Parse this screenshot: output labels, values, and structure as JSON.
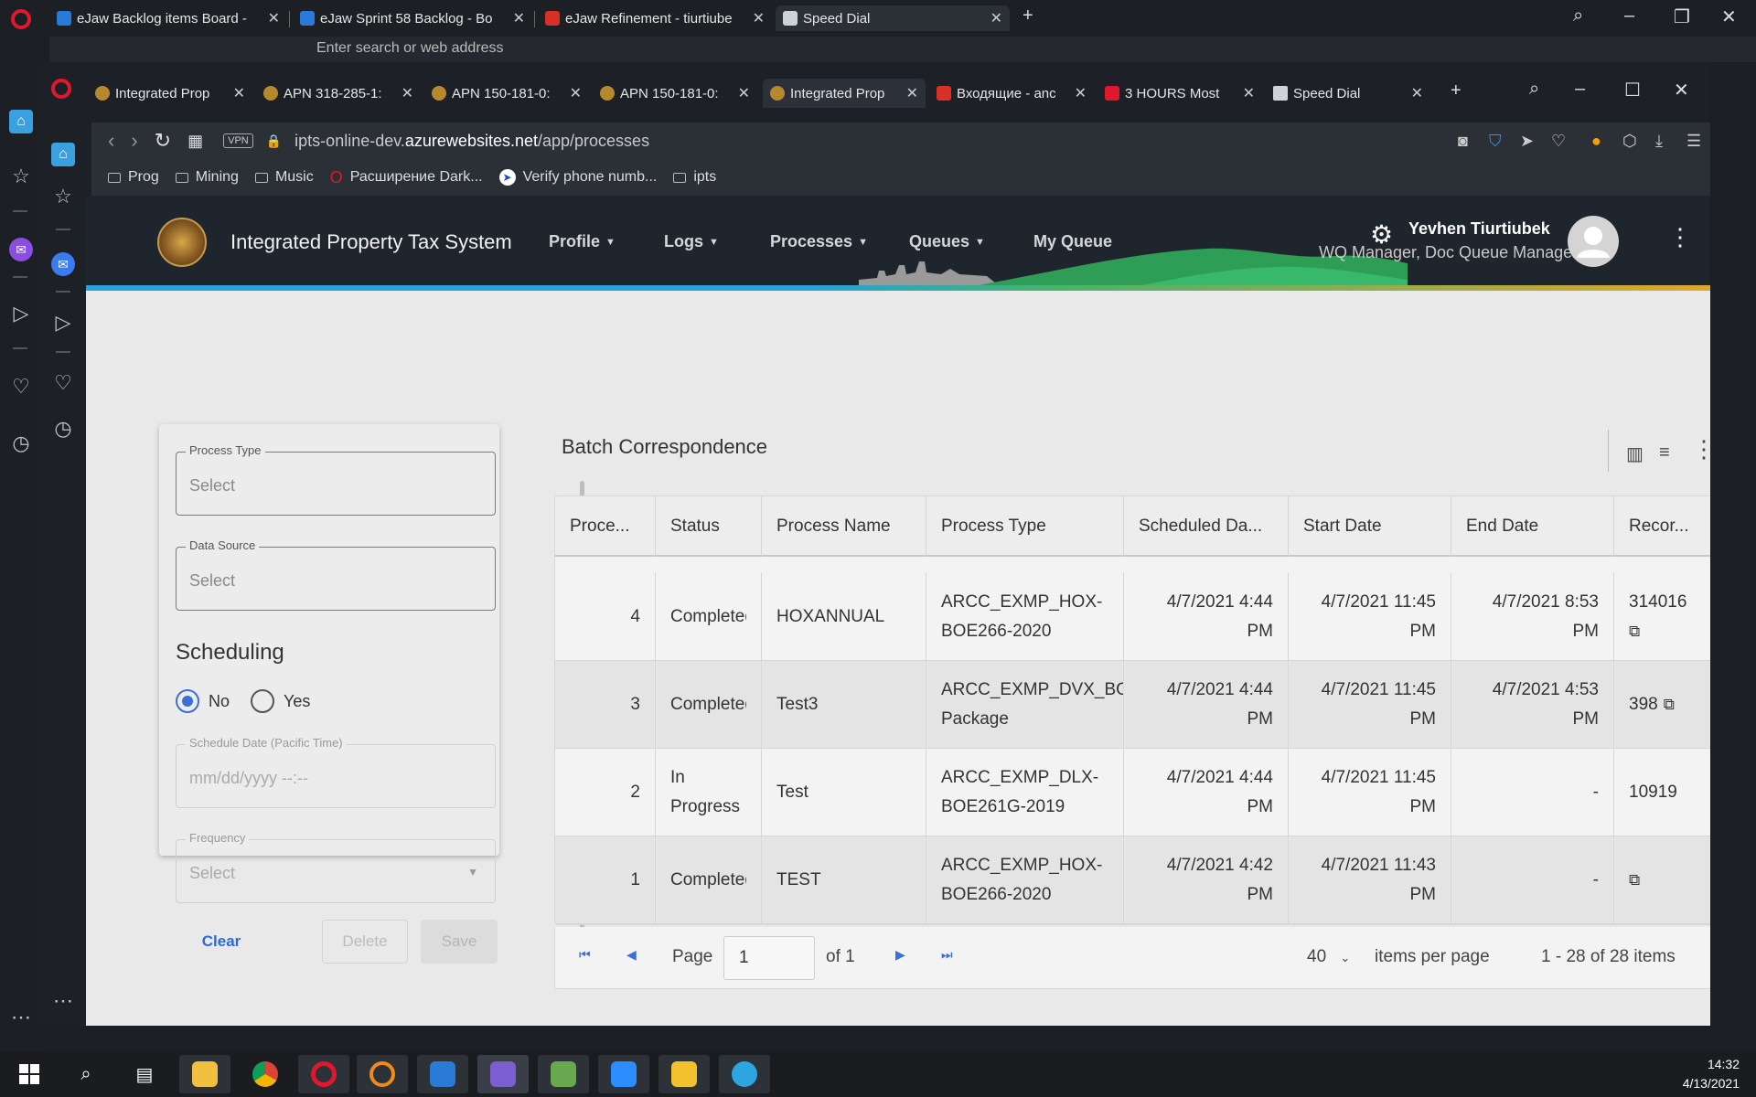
{
  "outer_tabs": [
    {
      "title": "eJaw Backlog items Board - ",
      "color": "#2a7bd8"
    },
    {
      "title": "eJaw Sprint 58 Backlog - Bo",
      "color": "#2a7bd8"
    },
    {
      "title": "eJaw Refinement - tiurtiube",
      "color": "#d93025"
    },
    {
      "title": "Speed Dial",
      "color": "#cfd3d8"
    }
  ],
  "outer_address_placeholder": "Enter search or web address",
  "inner_tabs": [
    {
      "title": "Integrated Prop"
    },
    {
      "title": "APN 318-285-1:"
    },
    {
      "title": "APN 150-181-0:"
    },
    {
      "title": "APN 150-181-0:"
    },
    {
      "title": "Integrated Prop"
    },
    {
      "title": "Входящие - anc"
    },
    {
      "title": "3 HOURS Most"
    },
    {
      "title": "Speed Dial"
    }
  ],
  "address": {
    "vpn": "VPN",
    "url_prefix": "ipts-online-dev.",
    "url_domain": "azurewebsites.net",
    "url_path": "/app/processes"
  },
  "bookmarks": [
    {
      "label": "Prog"
    },
    {
      "label": "Mining"
    },
    {
      "label": "Music"
    },
    {
      "label": "Расширение Dark..."
    },
    {
      "label": "Verify phone numb..."
    },
    {
      "label": "ipts"
    }
  ],
  "header": {
    "app_title": "Integrated Property Tax System",
    "menus": [
      "Profile",
      "Logs",
      "Processes",
      "Queues"
    ],
    "my_queue": "My Queue",
    "user_name": "Yevhen Tiurtiubek",
    "user_role": "WQ Manager, Doc Queue Manager"
  },
  "filters": {
    "process_type": {
      "label": "Process Type",
      "value": "Select"
    },
    "data_source": {
      "label": "Data Source",
      "value": "Select"
    },
    "scheduling_heading": "Scheduling",
    "radio_no": "No",
    "radio_yes": "Yes",
    "schedule_date": {
      "label": "Schedule Date (Pacific Time)",
      "value": "mm/dd/yyyy --:--"
    },
    "frequency": {
      "label": "Frequency",
      "value": "Select"
    },
    "clear": "Clear",
    "delete": "Delete",
    "save": "Save"
  },
  "table": {
    "title": "Batch Correspondence",
    "columns": [
      "Proce...",
      "Status",
      "Process Name",
      "Process Type",
      "Scheduled Da...",
      "Start Date",
      "End Date",
      "Recor..."
    ],
    "rows": [
      {
        "id": "4",
        "status": "Completed",
        "name": "HOXANNUAL",
        "type1": "ARCC_EXMP_HOX-",
        "type2": "BOE266-2020",
        "sched1": "4/7/2021 4:44",
        "sched2": "PM",
        "start1": "4/7/2021 11:45",
        "start2": "PM",
        "end1": "4/7/2021 8:53",
        "end2": "PM",
        "records": "314016"
      },
      {
        "id": "3",
        "status": "Completed",
        "name": "Test3",
        "type1": "ARCC_EXMP_DVX_BOE",
        "type2": "Package",
        "sched1": "4/7/2021 4:44",
        "sched2": "PM",
        "start1": "4/7/2021 11:45",
        "start2": "PM",
        "end1": "4/7/2021 4:53",
        "end2": "PM",
        "records": "398"
      },
      {
        "id": "2",
        "status1": "In",
        "status2": "Progress",
        "name": "Test",
        "type1": "ARCC_EXMP_DLX-",
        "type2": "BOE261G-2019",
        "sched1": "4/7/2021 4:44",
        "sched2": "PM",
        "start1": "4/7/2021 11:45",
        "start2": "PM",
        "end": "-",
        "records": "10919"
      },
      {
        "id": "1",
        "status": "Completed",
        "name": "TEST",
        "type1": "ARCC_EXMP_HOX-",
        "type2": "BOE266-2020",
        "sched1": "4/7/2021 4:42",
        "sched2": "PM",
        "start1": "4/7/2021 11:43",
        "start2": "PM",
        "end": "-",
        "records": ""
      }
    ]
  },
  "pager": {
    "page_label": "Page",
    "page_value": "1",
    "of_label": "of 1",
    "per_page": "40",
    "per_page_label": "items per page",
    "summary": "1 - 28 of 28 items"
  },
  "taskbar": {
    "time": "14:32",
    "date": "4/13/2021"
  }
}
